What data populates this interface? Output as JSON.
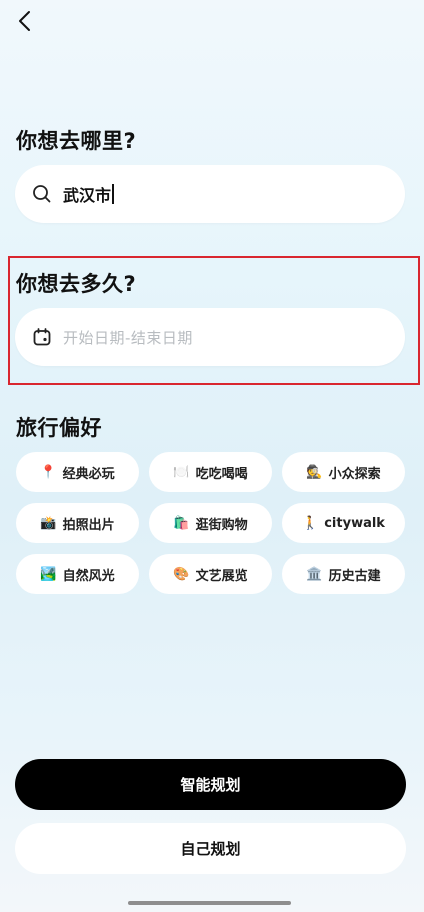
{
  "destination": {
    "title": "你想去哪里?",
    "value": "武汉市"
  },
  "duration": {
    "title": "你想去多久?",
    "placeholder": "开始日期-结束日期"
  },
  "preferences": {
    "title": "旅行偏好",
    "chips": [
      {
        "emoji": "📍",
        "label": "经典必玩"
      },
      {
        "emoji": "🍽️",
        "label": "吃吃喝喝"
      },
      {
        "emoji": "🕵️",
        "label": "小众探索"
      },
      {
        "emoji": "📸",
        "label": "拍照出片"
      },
      {
        "emoji": "🛍️",
        "label": "逛街购物"
      },
      {
        "emoji": "🚶",
        "label": "citywalk"
      },
      {
        "emoji": "🏞️",
        "label": "自然风光"
      },
      {
        "emoji": "🎨",
        "label": "文艺展览"
      },
      {
        "emoji": "🏛️",
        "label": "历史古建"
      }
    ]
  },
  "actions": {
    "smart_plan": "智能规划",
    "self_plan": "自己规划"
  },
  "colors": {
    "highlight": "#d9262f",
    "primary_button": "#000000"
  }
}
